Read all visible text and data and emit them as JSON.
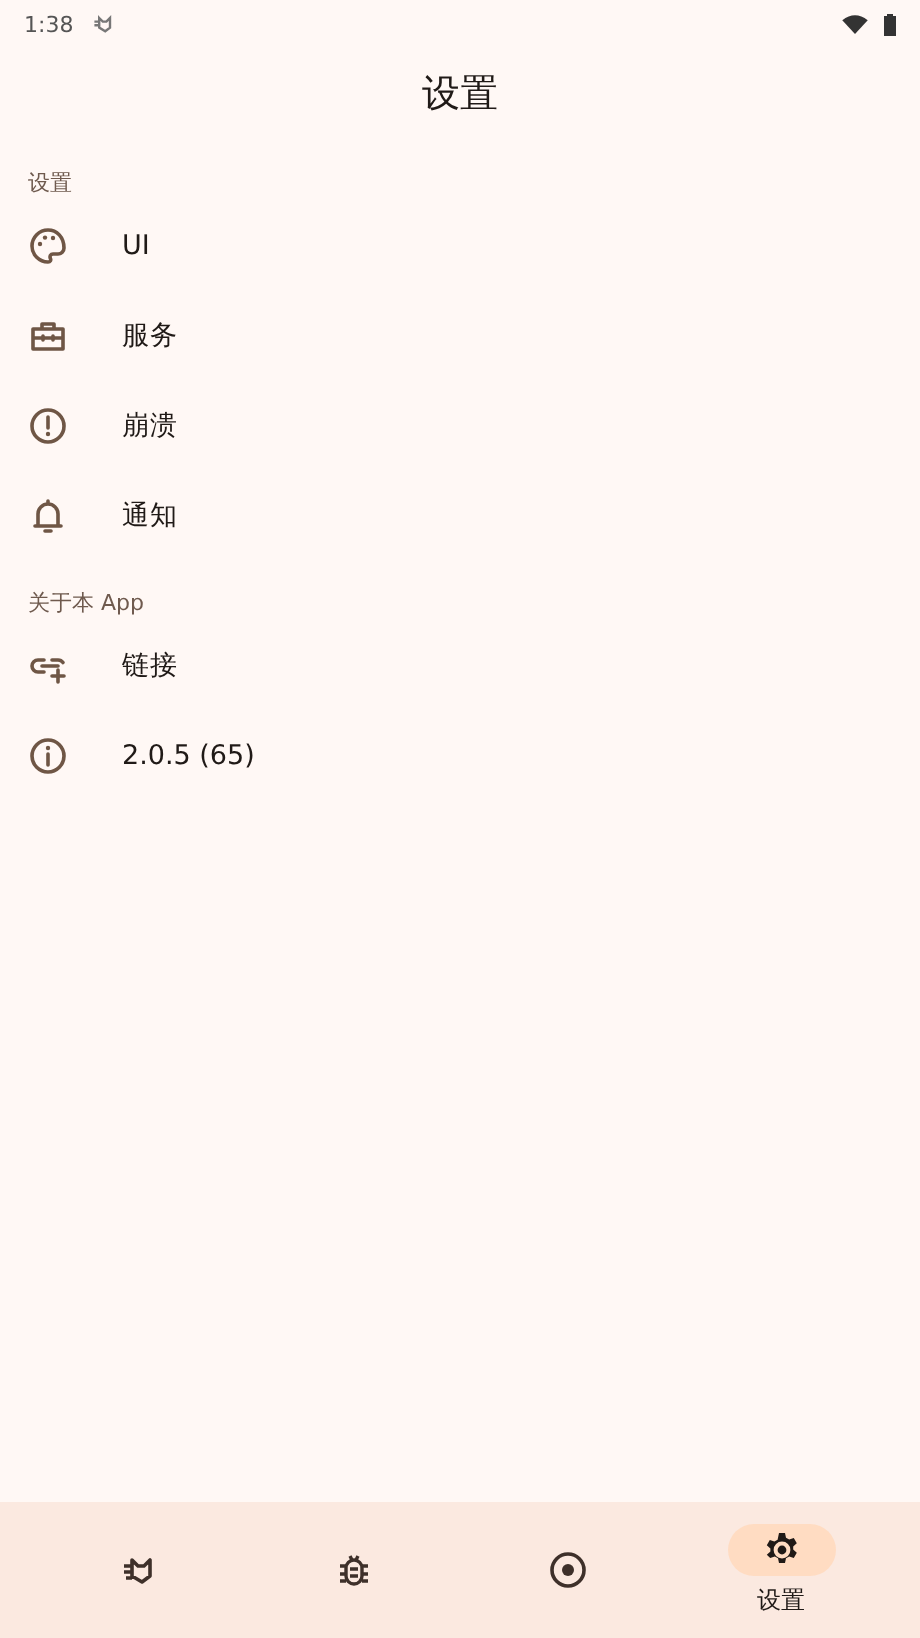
{
  "status_bar": {
    "time": "1:38"
  },
  "title": "设置",
  "sections": [
    {
      "header": "设置",
      "items": [
        {
          "kind": "palette",
          "label": "UI"
        },
        {
          "kind": "briefcase",
          "label": "服务"
        },
        {
          "kind": "alert",
          "label": "崩溃"
        },
        {
          "kind": "bell",
          "label": "通知"
        }
      ]
    },
    {
      "header": "关于本 App",
      "items": [
        {
          "kind": "link",
          "label": "链接"
        },
        {
          "kind": "info",
          "label": "2.0.5 (65)"
        }
      ]
    }
  ],
  "bottom_nav": [
    {
      "kind": "cat",
      "selected": false
    },
    {
      "kind": "bug",
      "selected": false
    },
    {
      "kind": "target",
      "selected": false
    },
    {
      "kind": "gear",
      "selected": true,
      "label": "设置"
    }
  ]
}
